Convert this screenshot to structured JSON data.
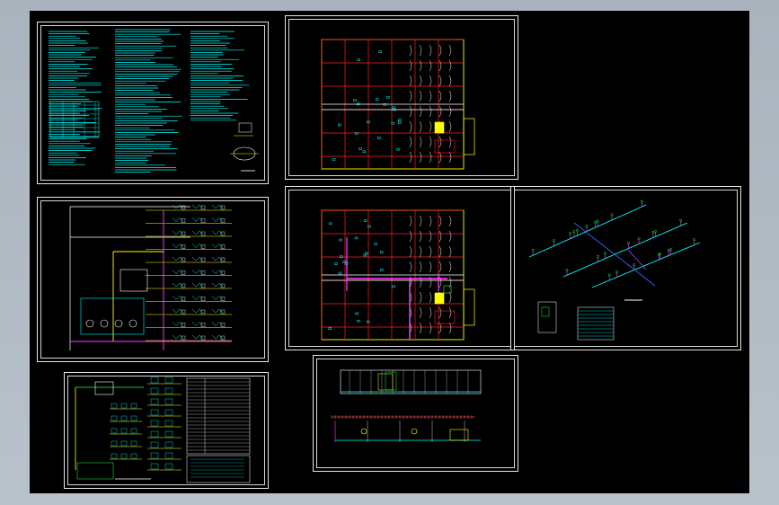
{
  "viewport": {
    "background": "#000000",
    "frame_color": "#b4bec8"
  },
  "sheets": [
    {
      "id": "design-notes",
      "kind": "text-notes"
    },
    {
      "id": "floor-plan-upper",
      "kind": "floor-plan"
    },
    {
      "id": "floor-plan-lower",
      "kind": "floor-plan"
    },
    {
      "id": "water-riser",
      "kind": "riser-diagram"
    },
    {
      "id": "isometric-piping",
      "kind": "isometric"
    },
    {
      "id": "drainage-riser",
      "kind": "riser-diagram"
    },
    {
      "id": "elevation-sections",
      "kind": "section"
    }
  ],
  "colors": {
    "cyan": "#00ffff",
    "red": "#ff2020",
    "yellow": "#ffff00",
    "magenta": "#ff40ff",
    "green": "#20ff40",
    "white": "#ffffff",
    "blue": "#4060ff",
    "violet": "#a040ff"
  }
}
